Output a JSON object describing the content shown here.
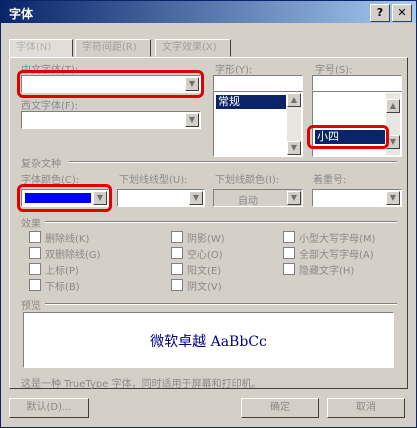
{
  "window": {
    "title": "字体",
    "help_button": "?",
    "close_button": "✕"
  },
  "tabs": [
    {
      "label": "字体(N)"
    },
    {
      "label": "字符间距(R)"
    },
    {
      "label": "文字效果(X)"
    }
  ],
  "font_panel": {
    "chinese_font_label": "中文字体(T):",
    "chinese_font_value": "",
    "western_font_label": "西文字体(F):",
    "western_font_value": "",
    "style_label": "字形(Y):",
    "style_value": "",
    "style_selected": "常规",
    "size_label": "字号(S):",
    "size_value": "",
    "size_selected": "小四"
  },
  "all_text": {
    "section_label": "复杂文种",
    "font_color_label": "字体颜色(C):",
    "underline_style_label": "下划线线型(U):",
    "underline_color_label": "下划线颜色(I):",
    "underline_color_value": "自动",
    "emphasis_label": "着重号:"
  },
  "effects": {
    "section_label": "效果",
    "checkboxes": [
      {
        "label": "删除线(K)"
      },
      {
        "label": "双删除线(G)"
      },
      {
        "label": "上标(P)"
      },
      {
        "label": "下标(B)"
      },
      {
        "label": "阴影(W)"
      },
      {
        "label": "空心(O)"
      },
      {
        "label": "阳文(E)"
      },
      {
        "label": "阴文(V)"
      },
      {
        "label": "小型大写字母(M)"
      },
      {
        "label": "全部大写字母(A)"
      },
      {
        "label": "隐藏文字(H)"
      }
    ]
  },
  "preview": {
    "section_label": "预览",
    "sample_text": "微软卓越 AaBbCc"
  },
  "footer_note": "这是一种 TrueType 字体，同时适用于屏幕和打印机。",
  "buttons": {
    "default_label": "默认(D)...",
    "ok_label": "确定",
    "cancel_label": "取消"
  },
  "colors": {
    "font_color_swatch": "#0000ff",
    "highlight": "#e00000",
    "title_start": "#0a246a",
    "title_end": "#a6caf0"
  }
}
